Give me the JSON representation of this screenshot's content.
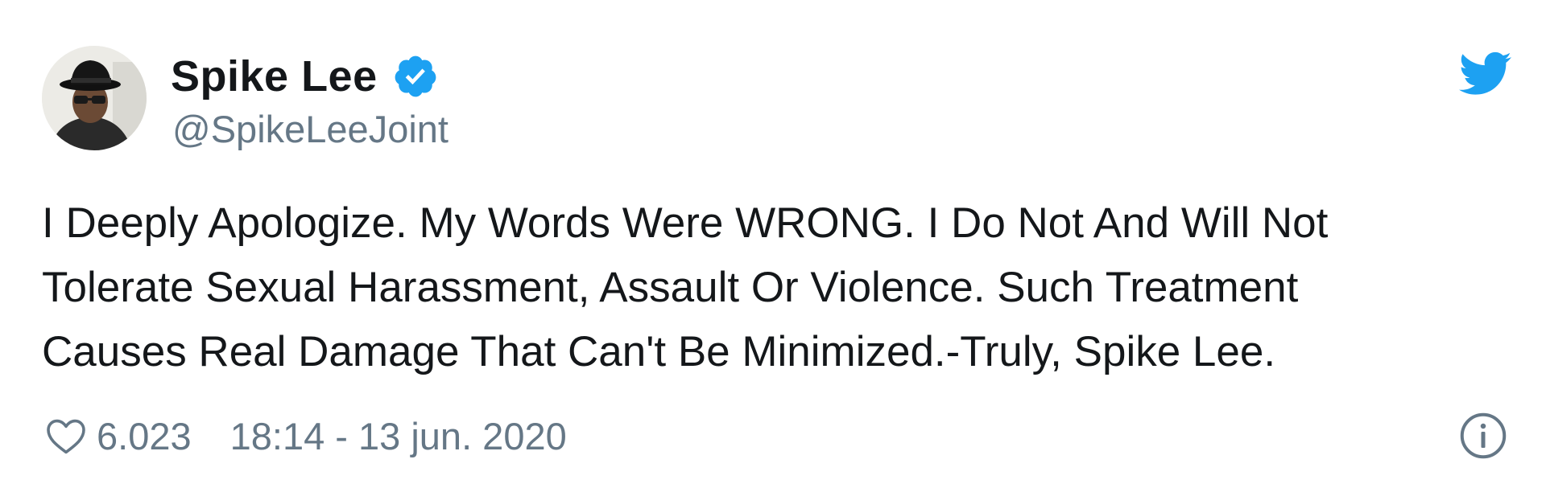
{
  "tweet": {
    "author": {
      "display_name": "Spike Lee",
      "handle": "@SpikeLeeJoint",
      "verified": true,
      "avatar_icon": "avatar-photo"
    },
    "text_lines": [
      "I Deeply Apologize. My Words Were WRONG. I Do Not And Will Not",
      "Tolerate Sexual Harassment, Assault Or Violence. Such Treatment",
      "Causes Real Damage That Can't Be Minimized.-Truly, Spike Lee."
    ],
    "likes": "6.023",
    "timestamp": "18:14 - 13 jun. 2020",
    "icons": {
      "brand": "twitter-bird-icon",
      "verified": "verified-badge-icon",
      "like": "heart-icon",
      "info": "info-icon"
    },
    "colors": {
      "brand_blue": "#1da1f2",
      "text_primary": "#14171a",
      "text_secondary": "#657786"
    }
  }
}
